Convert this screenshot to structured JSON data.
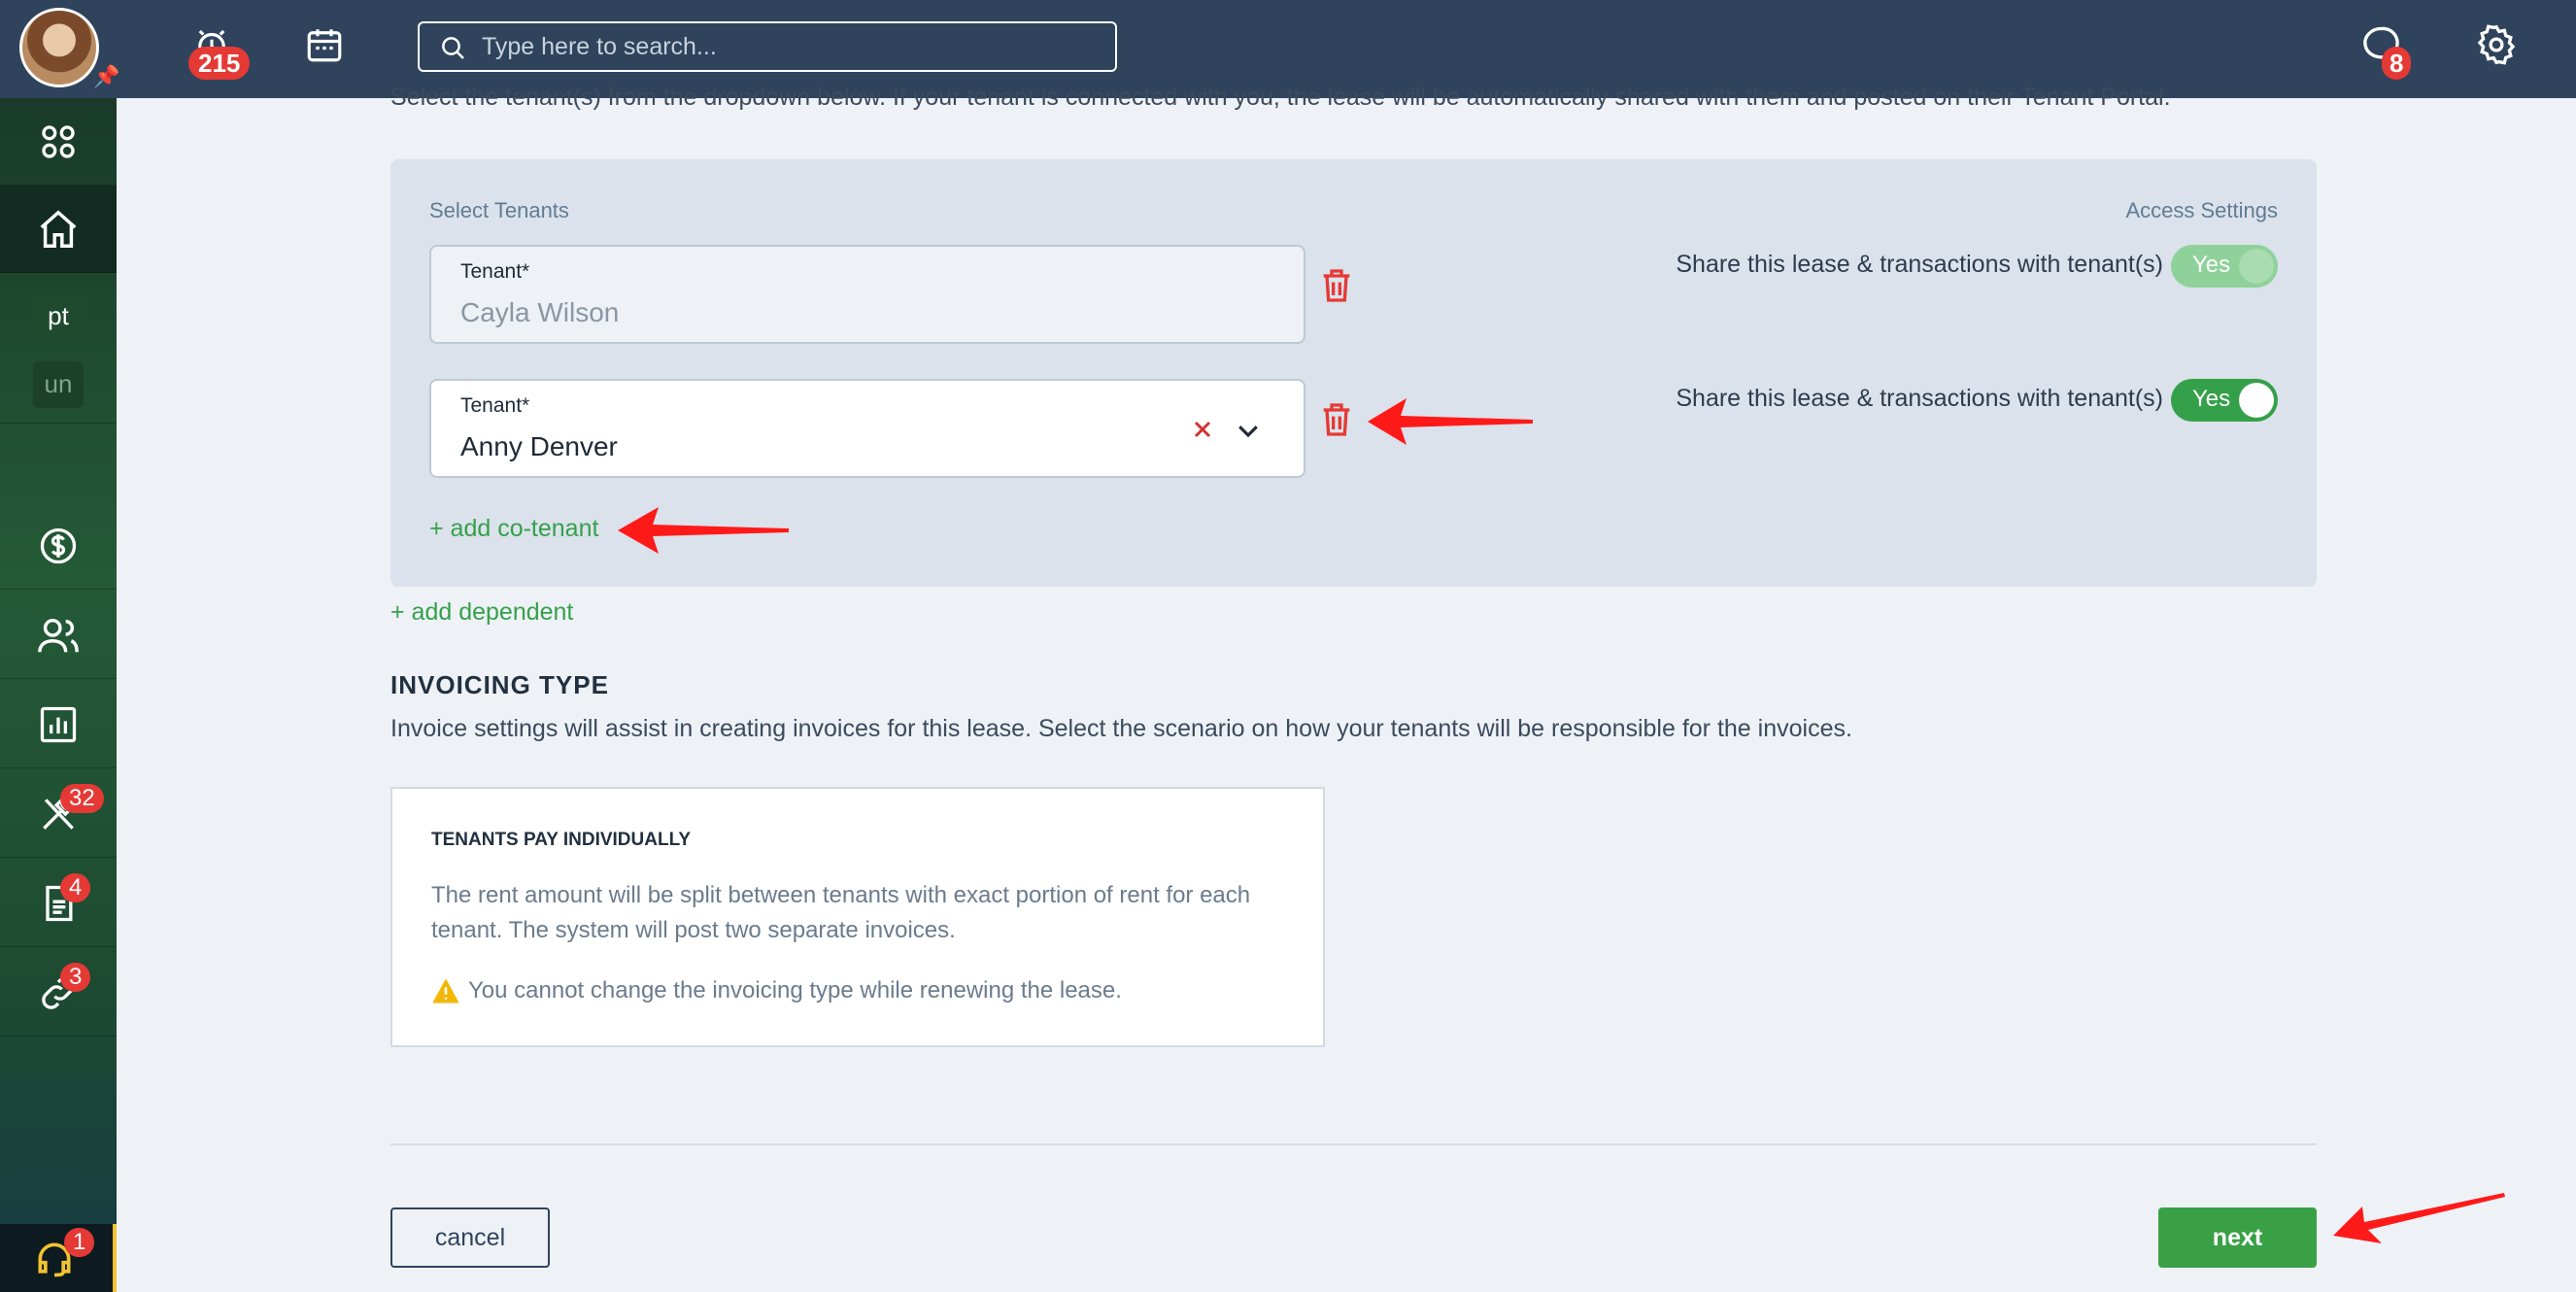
{
  "topbar": {
    "alarm_badge": "215",
    "chat_badge": "8",
    "search_placeholder": "Type here to search..."
  },
  "sidebar": {
    "items": [
      {
        "name": "apps-icon"
      },
      {
        "name": "home-icon"
      },
      {
        "label": "pt"
      },
      {
        "label": "un"
      },
      {
        "name": "dollar-icon"
      },
      {
        "name": "people-icon"
      },
      {
        "name": "chart-icon"
      },
      {
        "name": "tools-icon",
        "badge": "32"
      },
      {
        "name": "document-icon",
        "badge": "4"
      },
      {
        "name": "link-icon",
        "badge": "3"
      }
    ],
    "support_badge": "1"
  },
  "intro_text": "Select the tenant(s) from the dropdown below. If your tenant is connected with you, the lease will be automatically shared with them and posted on their Tenant Portal.",
  "tenants": {
    "select_label": "Select Tenants",
    "access_label": "Access Settings",
    "rows": [
      {
        "field_label": "Tenant*",
        "value": "Cayla Wilson",
        "share_text": "Share this lease & transactions with tenant(s)",
        "toggle": "Yes"
      },
      {
        "field_label": "Tenant*",
        "value": "Anny Denver",
        "share_text": "Share this lease & transactions with tenant(s)",
        "toggle": "Yes"
      }
    ],
    "add_cotenant": "+ add co-tenant"
  },
  "add_dependent": "+ add dependent",
  "invoicing": {
    "title": "INVOICING TYPE",
    "description": "Invoice settings will assist in creating invoices for this lease. Select the scenario on how your tenants will be responsible for the invoices.",
    "card_title": "TENANTS PAY INDIVIDUALLY",
    "card_text": "The rent amount will be split between tenants with exact portion of rent for each tenant. The system will post two separate invoices.",
    "warning": "You cannot change the invoicing type while renewing the lease."
  },
  "buttons": {
    "cancel": "cancel",
    "next": "next"
  },
  "colors": {
    "topbar": "#2f435c",
    "accent_green": "#3aa046",
    "badge_red": "#e53935",
    "annotation_red": "#ff1a1a"
  }
}
